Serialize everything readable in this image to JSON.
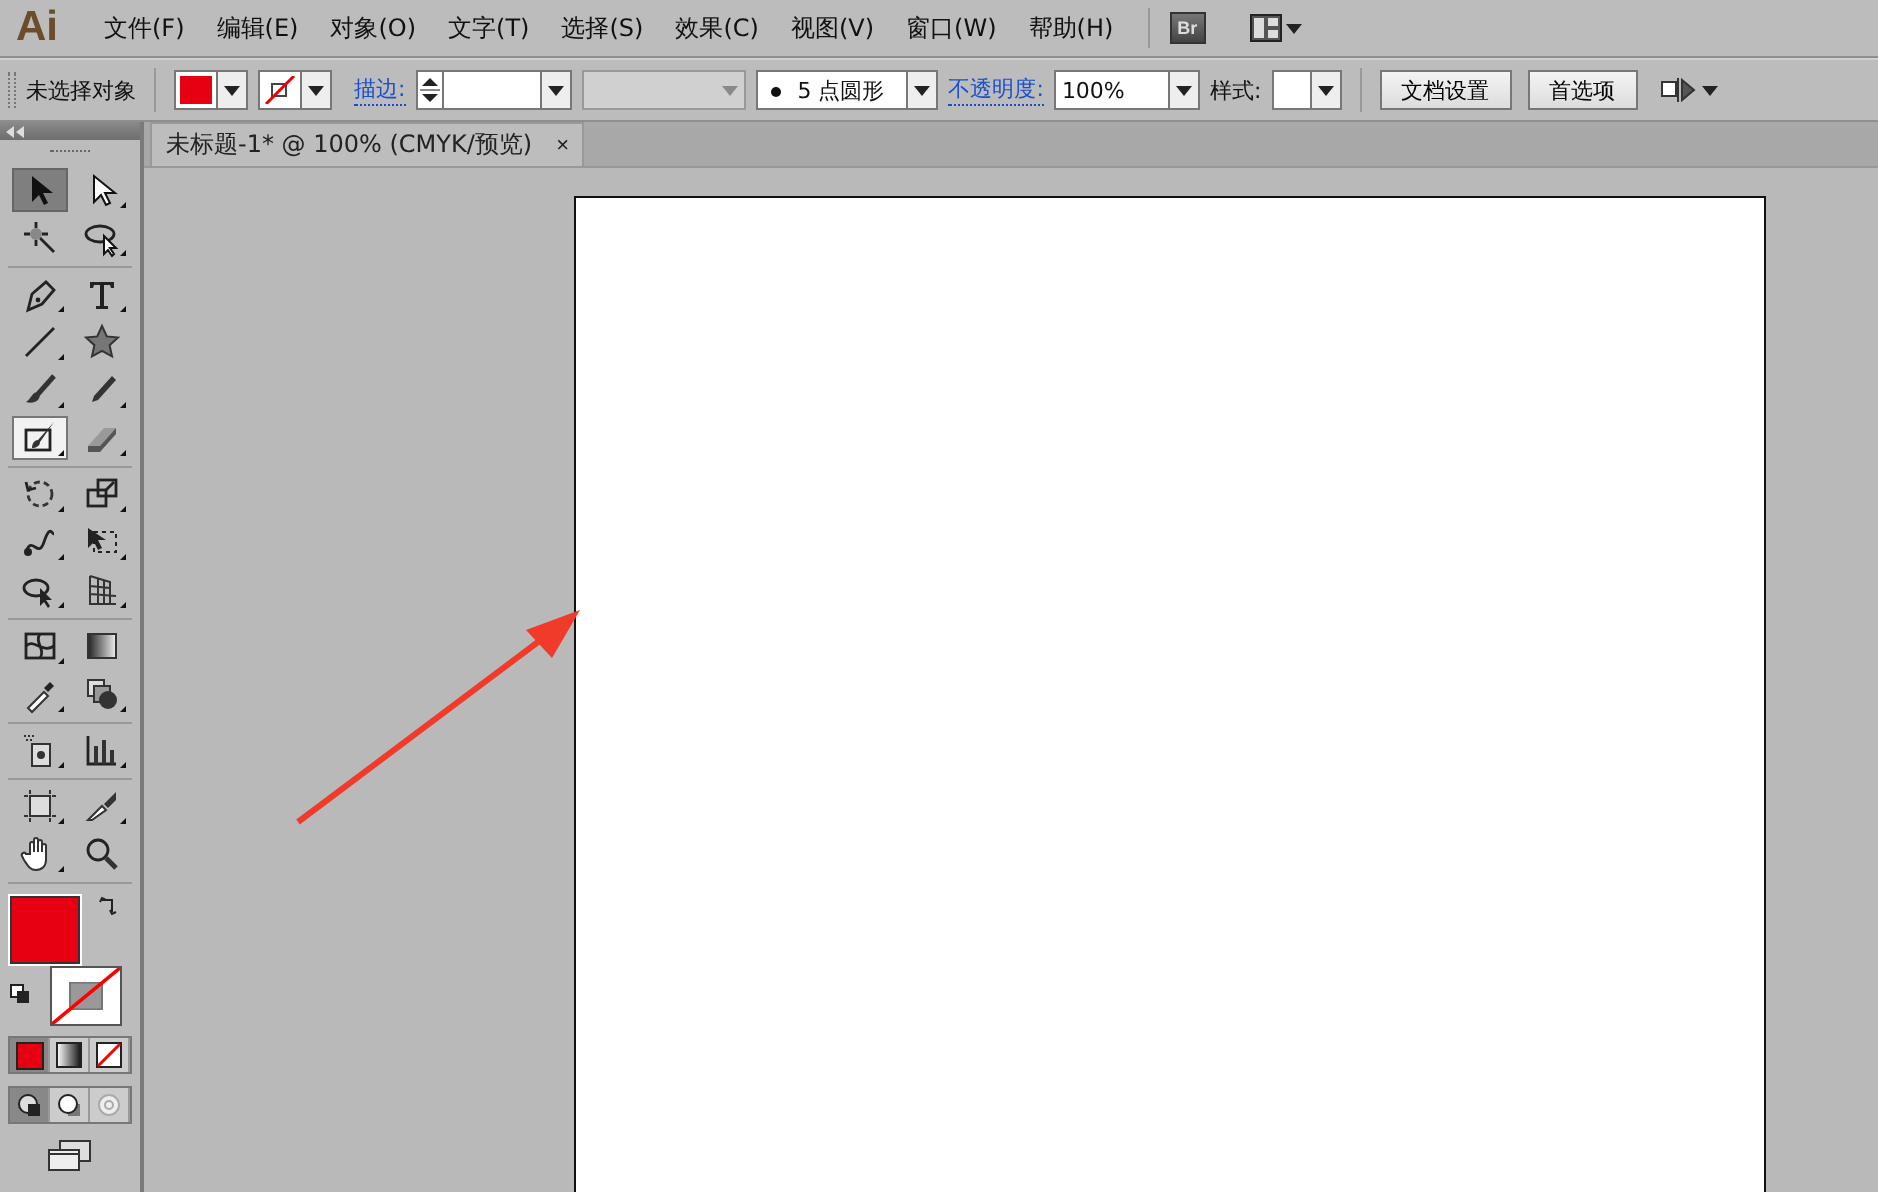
{
  "app_logo": "Ai",
  "menu": [
    "文件(F)",
    "编辑(E)",
    "对象(O)",
    "文字(T)",
    "选择(S)",
    "效果(C)",
    "视图(V)",
    "窗口(W)",
    "帮助(H)"
  ],
  "bridge_button": "Br",
  "control_bar": {
    "selection_label": "未选择对象",
    "fill": {
      "color": "#e60012"
    },
    "stroke_label": "描边:",
    "brush": "5 点圆形",
    "opacity_label": "不透明度:",
    "opacity": "100%",
    "style_label": "样式:",
    "buttons": [
      "文档设置",
      "首选项"
    ]
  },
  "toolbox": {
    "tool_groups": [
      [
        {
          "kind": "selection",
          "selected": true,
          "highlighted": false
        },
        {
          "kind": "direct-selection",
          "selected": false,
          "highlighted": false
        },
        {
          "kind": "magic-wand",
          "selected": false,
          "highlighted": false
        },
        {
          "kind": "lasso",
          "selected": false,
          "highlighted": false
        }
      ],
      [
        {
          "kind": "pen",
          "selected": false,
          "highlighted": false
        },
        {
          "kind": "type",
          "selected": false,
          "highlighted": false
        },
        {
          "kind": "line",
          "selected": false,
          "highlighted": false
        },
        {
          "kind": "star",
          "selected": false,
          "highlighted": false
        },
        {
          "kind": "paintbrush",
          "selected": false,
          "highlighted": false
        },
        {
          "kind": "pencil",
          "selected": false,
          "highlighted": false
        },
        {
          "kind": "blob-brush",
          "selected": false,
          "highlighted": true
        },
        {
          "kind": "eraser",
          "selected": false,
          "highlighted": false
        }
      ],
      [
        {
          "kind": "rotate",
          "selected": false,
          "highlighted": false
        },
        {
          "kind": "scale",
          "selected": false,
          "highlighted": false
        },
        {
          "kind": "warp",
          "selected": false,
          "highlighted": false
        },
        {
          "kind": "free-transform",
          "selected": false,
          "highlighted": false
        },
        {
          "kind": "shape-builder",
          "selected": false,
          "highlighted": false
        },
        {
          "kind": "perspective-grid",
          "selected": false,
          "highlighted": false
        }
      ],
      [
        {
          "kind": "mesh",
          "selected": false,
          "highlighted": false
        },
        {
          "kind": "gradient",
          "selected": false,
          "highlighted": false
        },
        {
          "kind": "eyedropper",
          "selected": false,
          "highlighted": false
        },
        {
          "kind": "blend",
          "selected": false,
          "highlighted": false
        }
      ],
      [
        {
          "kind": "symbol-sprayer",
          "selected": false,
          "highlighted": false
        },
        {
          "kind": "column-graph",
          "selected": false,
          "highlighted": false
        }
      ],
      [
        {
          "kind": "artboard",
          "selected": false,
          "highlighted": false
        },
        {
          "kind": "slice",
          "selected": false,
          "highlighted": false
        },
        {
          "kind": "hand",
          "selected": false,
          "highlighted": false
        },
        {
          "kind": "zoom",
          "selected": false,
          "highlighted": false
        }
      ]
    ],
    "fill": {
      "color": "#e60012"
    },
    "color_modes": [
      {
        "kind": "color",
        "selected": true
      },
      {
        "kind": "gradient",
        "selected": false
      },
      {
        "kind": "none",
        "selected": false
      }
    ],
    "draw_modes": [
      {
        "kind": "normal",
        "selected": true
      },
      {
        "kind": "behind",
        "selected": false
      },
      {
        "kind": "inside",
        "selected": false
      }
    ]
  },
  "document": {
    "tab_title": "未标题-1* @ 100% (CMYK/预览)",
    "tab_close": "×"
  }
}
